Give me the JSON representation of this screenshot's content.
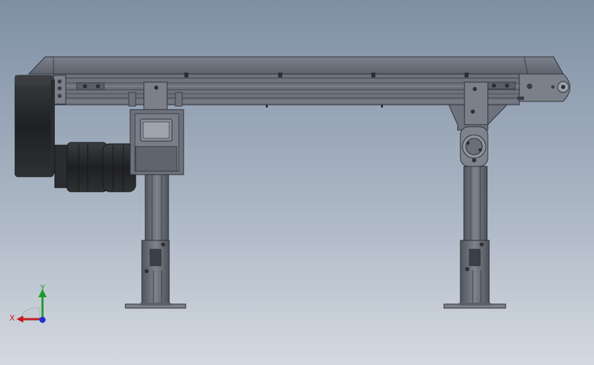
{
  "viewport": {
    "background_top": "#7e8fa4",
    "background_bottom": "#d3d9e1"
  },
  "model": {
    "description_icon": "belt-conveyor-assembly-icon",
    "metal_color": "#6e7480",
    "edge_color": "#2b2f36",
    "motor_color": "#2c2e31"
  },
  "triad": {
    "x_label": "X",
    "y_label": "Y",
    "x_color": "#c8191e",
    "y_color": "#1a9a2a",
    "z_color": "#1a2fd0"
  }
}
